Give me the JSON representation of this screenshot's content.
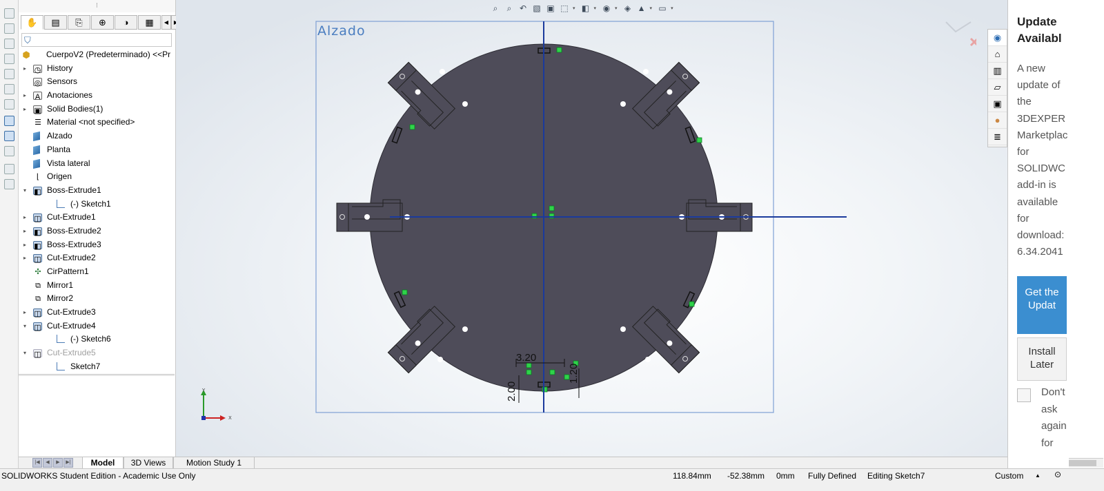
{
  "feature_manager": {
    "tabs": [
      "feature-manager",
      "property-manager",
      "configuration-manager",
      "dimxpert-manager",
      "display-manager",
      "cam-tab"
    ],
    "tree": [
      {
        "label": "CuerpoV2 (Predeterminado) <<Pr",
        "icon": "part-icon",
        "level": 0,
        "expander": ""
      },
      {
        "label": "History",
        "icon": "history-icon",
        "level": 1,
        "expander": "▸"
      },
      {
        "label": "Sensors",
        "icon": "sensors-icon",
        "level": 1,
        "expander": ""
      },
      {
        "label": "Anotaciones",
        "icon": "annotations-icon",
        "level": 1,
        "expander": "▸"
      },
      {
        "label": "Solid Bodies(1)",
        "icon": "solid-bodies-icon",
        "level": 1,
        "expander": "▸"
      },
      {
        "label": "Material <not specified>",
        "icon": "material-icon",
        "level": 1,
        "expander": ""
      },
      {
        "label": "Alzado",
        "icon": "plane-icon",
        "level": 1,
        "expander": ""
      },
      {
        "label": "Planta",
        "icon": "plane-icon",
        "level": 1,
        "expander": ""
      },
      {
        "label": "Vista lateral",
        "icon": "plane-icon",
        "level": 1,
        "expander": ""
      },
      {
        "label": "Origen",
        "icon": "origin-icon",
        "level": 1,
        "expander": ""
      },
      {
        "label": "Boss-Extrude1",
        "icon": "boss-extrude-icon",
        "level": 1,
        "expander": "▾"
      },
      {
        "label": "(-) Sketch1",
        "icon": "sketch-icon",
        "level": 2,
        "expander": ""
      },
      {
        "label": "Cut-Extrude1",
        "icon": "cut-extrude-icon",
        "level": 1,
        "expander": "▸"
      },
      {
        "label": "Boss-Extrude2",
        "icon": "boss-extrude-icon",
        "level": 1,
        "expander": "▸"
      },
      {
        "label": "Boss-Extrude3",
        "icon": "boss-extrude-icon",
        "level": 1,
        "expander": "▸"
      },
      {
        "label": "Cut-Extrude2",
        "icon": "cut-extrude-icon",
        "level": 1,
        "expander": "▸"
      },
      {
        "label": "CirPattern1",
        "icon": "circular-pattern-icon",
        "level": 1,
        "expander": ""
      },
      {
        "label": "Mirror1",
        "icon": "mirror-icon",
        "level": 1,
        "expander": ""
      },
      {
        "label": "Mirror2",
        "icon": "mirror-icon",
        "level": 1,
        "expander": ""
      },
      {
        "label": "Cut-Extrude3",
        "icon": "cut-extrude-icon",
        "level": 1,
        "expander": "▸"
      },
      {
        "label": "Cut-Extrude4",
        "icon": "cut-extrude-icon",
        "level": 1,
        "expander": "▾"
      },
      {
        "label": "(-) Sketch6",
        "icon": "sketch-icon",
        "level": 2,
        "expander": ""
      },
      {
        "label": "Cut-Extrude5",
        "icon": "cut-extrude-icon",
        "level": 1,
        "expander": "▾",
        "dim": true
      },
      {
        "label": "Sketch7",
        "icon": "sketch-icon",
        "level": 2,
        "expander": ""
      }
    ]
  },
  "graphics": {
    "view_label": "Alzado",
    "dimensions": [
      "3.20",
      "2.00",
      "1.20"
    ],
    "triad_axes": {
      "x": "X",
      "y": "Y"
    },
    "colors": {
      "body": "#4e4c59",
      "view_frame": "#7fa0d4",
      "axis": "#1a3a9c",
      "relation": "#2fd34a"
    }
  },
  "task_pane": {
    "tabs": [
      "3dexperience-icon",
      "home-icon",
      "design-library-icon",
      "file-explorer-icon",
      "view-palette-icon",
      "appearances-icon",
      "custom-properties-icon"
    ]
  },
  "update_panel": {
    "title_line1": "Update",
    "title_line2": "Availabl",
    "body_lines": [
      "A new",
      "update of",
      "the",
      "3DEXPER",
      "Marketplac",
      "for",
      "SOLIDWC",
      "add-in is",
      "available",
      "for",
      "download:",
      "6.34.2041"
    ],
    "get_update": "Get the Updat",
    "install_later": "Install Later",
    "dont_ask": "Don't ask again for"
  },
  "bottom_tabs": [
    "Model",
    "3D Views",
    "Motion Study 1"
  ],
  "status_bar": {
    "edition": "SOLIDWORKS Student Edition - Academic Use Only",
    "x": "118.84mm",
    "y": "-52.38mm",
    "z": "0mm",
    "state": "Fully Defined",
    "editing": "Editing Sketch7",
    "units": "Custom"
  }
}
